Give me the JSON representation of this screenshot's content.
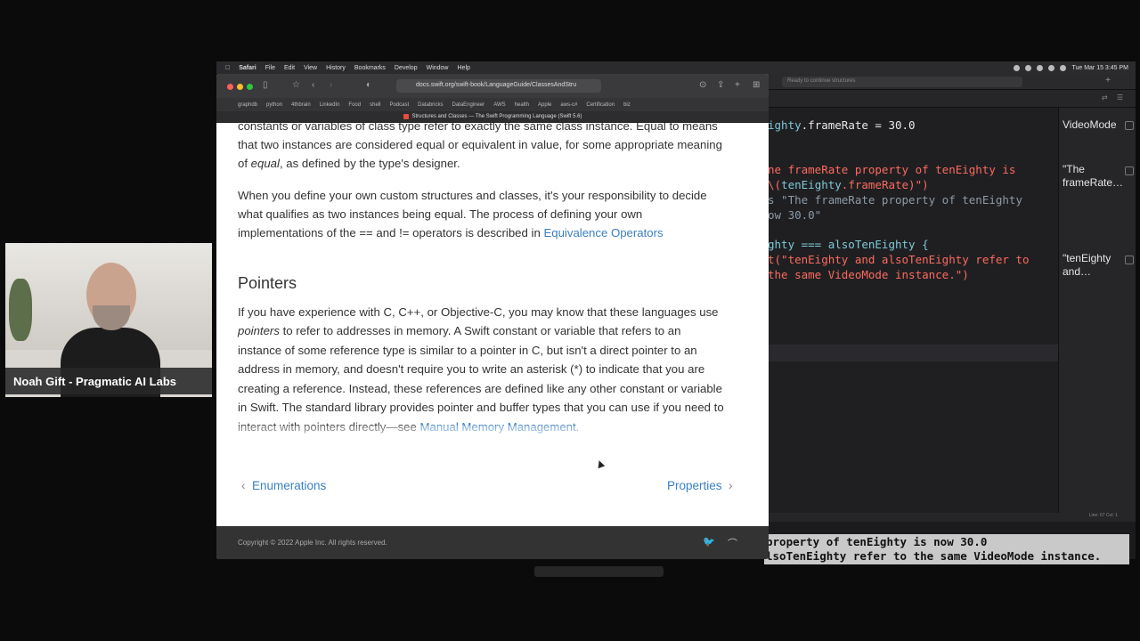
{
  "menubar": {
    "app": "Safari",
    "items": [
      "File",
      "Edit",
      "View",
      "History",
      "Bookmarks",
      "Develop",
      "Window",
      "Help"
    ],
    "clock": "Tue Mar 15  3:45 PM"
  },
  "safari": {
    "url": "docs.swift.org/swift-book/LanguageGuide/ClassesAndStru",
    "bookmarks": [
      "graphdb",
      "python",
      "4thbrain",
      "LinkedIn",
      "Food",
      "shell",
      "Podcast",
      "Databricks",
      "DataEngineer",
      "AWS",
      "health",
      "Apple",
      "aws-c#",
      "Certification",
      "biz"
    ],
    "tab_title": "Structures and Classes — The Swift Programming Language (Swift 5.6)"
  },
  "doc": {
    "para0_l1": "constants or variables of class type refer to exactly the same class instance. Equal to means",
    "para0_l2": "that two instances are considered equal or equivalent in value, for some appropriate meaning",
    "para0_l3a": "of ",
    "para0_l3em": "equal",
    "para0_l3b": ", as defined by the type's designer.",
    "para1_l1": "When you define your own custom structures and classes, it's your responsibility to decide",
    "para1_l2": "what qualifies as two instances being equal. The process of defining your own",
    "para1_l3a": "implementations of the == and != operators is described in ",
    "para1_link": "Equivalence Operators",
    "heading": "Pointers",
    "para2_l1": "If you have experience with C, C++, or Objective-C, you may know that these languages use",
    "para2_l2em": "pointers",
    "para2_l2b": " to refer to addresses in memory. A Swift constant or variable that refers to an",
    "para2_l3": "instance of some reference type is similar to a pointer in C, but isn't a direct pointer to an",
    "para2_l4": "address in memory, and doesn't require you to write an asterisk (*) to indicate that you are",
    "para2_l5": "creating a reference. Instead, these references are defined like any other constant or variable",
    "para2_l6": "in Swift. The standard library provides pointer and buffer types that you can use if you need to",
    "para2_l7a": "interact with pointers directly—see ",
    "para2_link": "Manual Memory Management.",
    "prev": "Enumerations",
    "next": "Properties",
    "copyright": "Copyright © 2022 Apple Inc. All rights reserved."
  },
  "xcode": {
    "search_placeholder": "Ready to continue structures",
    "code": {
      "l1_prop": "ighty",
      "l1_rest": ".frameRate = 30.0",
      "l2": "ne frameRate property of tenEighty is",
      "l3a": "\\(",
      "l3p": "tenEighty",
      "l3b": ".frameRate)\")",
      "l4": "s \"The frameRate property of tenEighty",
      "l5": "ow 30.0\"",
      "l6a": "ghty === alsoTenEighty {",
      "l7": "t(\"tenEighty and alsoTenEighty refer to",
      "l8": "the same VideoMode instance.\")"
    },
    "results": [
      "VideoMode",
      "\"The frameRate…",
      "\"tenEighty and…"
    ],
    "status": "Line: 67  Col: 1"
  },
  "console": {
    "line1": "property of tenEighty is now 30.0",
    "line2": "lsoTenEighty refer to the same VideoMode instance."
  },
  "webcam": {
    "name": "Noah Gift - Pragmatic AI Labs"
  }
}
